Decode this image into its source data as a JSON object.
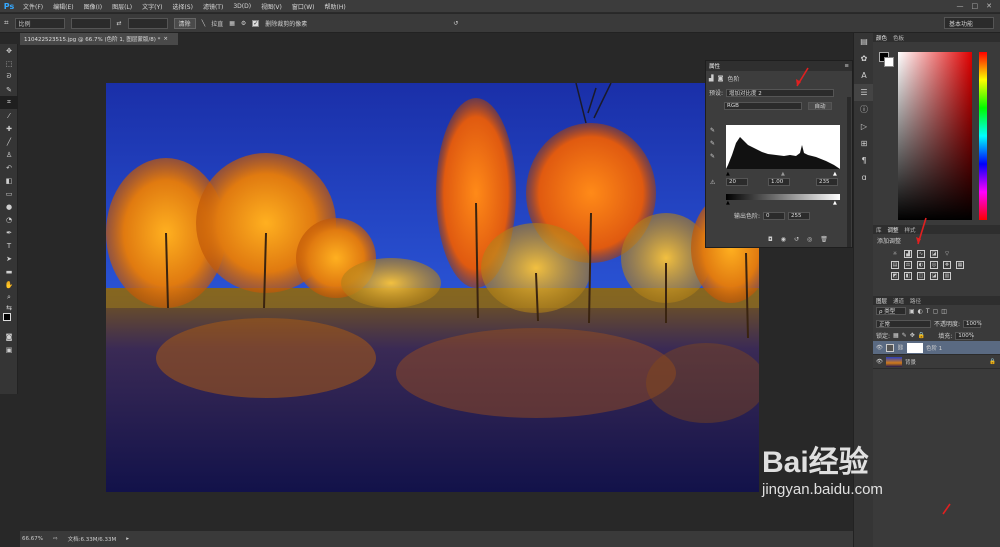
{
  "app": {
    "logo": "Ps"
  },
  "menu": [
    "文件(F)",
    "编辑(E)",
    "图像(I)",
    "图层(L)",
    "文字(Y)",
    "选择(S)",
    "滤镜(T)",
    "3D(D)",
    "视图(V)",
    "窗口(W)",
    "帮助(H)"
  ],
  "window_controls": [
    "—",
    "□",
    "✕"
  ],
  "options": {
    "ratio_label": "比例",
    "swap_icon": "⇄",
    "clear_label": "清除",
    "straighten_label": "拉直",
    "delete_crop_label": "删除裁剪的像素",
    "workspace": "基本功能"
  },
  "document": {
    "tab_title": "110422523515.jpg @ 66.7% (色阶 1, 图层蒙版/8) *",
    "close": "×"
  },
  "status": {
    "zoom": "66.67%",
    "doc_info": "文档:6.33M/6.33M"
  },
  "properties": {
    "tab": "属性",
    "title": "色阶",
    "preset_label": "预设:",
    "preset_value": "增加对比度 2",
    "channel": "RGB",
    "auto_label": "自动",
    "input_black": "20",
    "input_gamma": "1.00",
    "input_white": "235",
    "output_label": "输出色阶:",
    "output_black": "0",
    "output_white": "255"
  },
  "color_panel": {
    "tabs": [
      "颜色",
      "色板"
    ]
  },
  "adjustments_panel": {
    "tabs": [
      "库",
      "调整",
      "样式"
    ],
    "add_label": "添加调整"
  },
  "layers_panel": {
    "tabs": [
      "图层",
      "通道",
      "路径"
    ],
    "filter": "ρ 类型",
    "blend_mode": "正常",
    "opacity_label": "不透明度:",
    "opacity": "100%",
    "lock_label": "锁定:",
    "fill_label": "填充:",
    "fill": "100%",
    "layers": [
      {
        "name": "色阶 1",
        "selected": true
      },
      {
        "name": "背景",
        "selected": false
      }
    ]
  },
  "watermark": {
    "brand": "Bai经验",
    "url": "jingyan.baidu.com"
  },
  "colors": {
    "accent": "#35a8ff",
    "arrow": "#e02020"
  }
}
